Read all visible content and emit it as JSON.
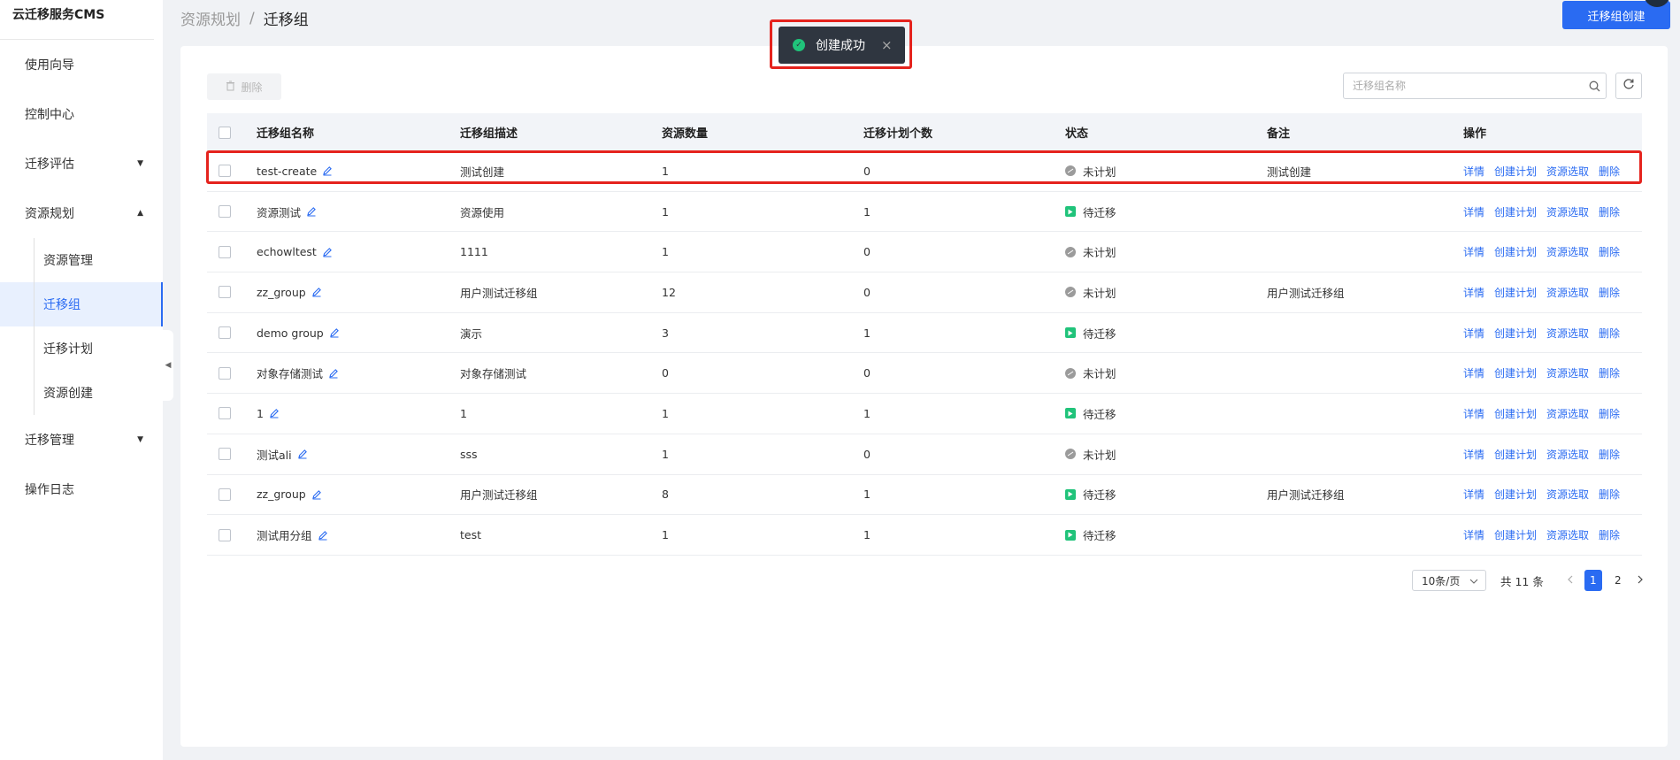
{
  "app": {
    "title": "云迁移服务CMS"
  },
  "sidebar": {
    "items": [
      {
        "label": "使用向导"
      },
      {
        "label": "控制中心"
      },
      {
        "label": "迁移评估"
      },
      {
        "label": "资源规划"
      },
      {
        "label": "迁移管理"
      },
      {
        "label": "操作日志"
      }
    ],
    "sub_items": [
      {
        "label": "资源管理"
      },
      {
        "label": "迁移组"
      },
      {
        "label": "迁移计划"
      },
      {
        "label": "资源创建"
      }
    ],
    "active_sub": "迁移组"
  },
  "breadcrumb": {
    "parent": "资源规划",
    "separator": "/",
    "current": "迁移组"
  },
  "header": {
    "create_button": "迁移组创建"
  },
  "toast": {
    "message": "创建成功",
    "close": "×"
  },
  "toolbar": {
    "delete_label": "删除",
    "search_placeholder": "迁移组名称"
  },
  "table": {
    "columns": [
      "迁移组名称",
      "迁移组描述",
      "资源数量",
      "迁移计划个数",
      "状态",
      "备注",
      "操作"
    ],
    "actions": [
      "详情",
      "创建计划",
      "资源选取",
      "删除"
    ],
    "rows": [
      {
        "name": "test-create",
        "desc": "测试创建",
        "count": "1",
        "plans": "0",
        "status": "未计划",
        "status_kind": "plan",
        "note": "测试创建"
      },
      {
        "name": "资源测试",
        "desc": "资源使用",
        "count": "1",
        "plans": "1",
        "status": "待迁移",
        "status_kind": "wait",
        "note": ""
      },
      {
        "name": "echowltest",
        "desc": "1111",
        "count": "1",
        "plans": "0",
        "status": "未计划",
        "status_kind": "plan",
        "note": ""
      },
      {
        "name": "zz_group",
        "desc": "用户测试迁移组",
        "count": "12",
        "plans": "0",
        "status": "未计划",
        "status_kind": "plan",
        "note": "用户测试迁移组"
      },
      {
        "name": "demo group",
        "desc": "演示",
        "count": "3",
        "plans": "1",
        "status": "待迁移",
        "status_kind": "wait",
        "note": ""
      },
      {
        "name": "对象存储测试",
        "desc": "对象存储测试",
        "count": "0",
        "plans": "0",
        "status": "未计划",
        "status_kind": "plan",
        "note": ""
      },
      {
        "name": "1",
        "desc": "1",
        "count": "1",
        "plans": "1",
        "status": "待迁移",
        "status_kind": "wait",
        "note": ""
      },
      {
        "name": "测试ali",
        "desc": "sss",
        "count": "1",
        "plans": "0",
        "status": "未计划",
        "status_kind": "plan",
        "note": ""
      },
      {
        "name": "zz_group",
        "desc": "用户测试迁移组",
        "count": "8",
        "plans": "1",
        "status": "待迁移",
        "status_kind": "wait",
        "note": "用户测试迁移组"
      },
      {
        "name": "测试用分组",
        "desc": "test",
        "count": "1",
        "plans": "1",
        "status": "待迁移",
        "status_kind": "wait",
        "note": ""
      }
    ]
  },
  "pagination": {
    "page_size": "10条/页",
    "total": "共 11 条",
    "pages": [
      "1",
      "2"
    ],
    "current": "1"
  },
  "colors": {
    "primary": "#2a6bf2",
    "success": "#20c37a",
    "highlight": "#e5231d",
    "muted": "#9b9b9b"
  }
}
